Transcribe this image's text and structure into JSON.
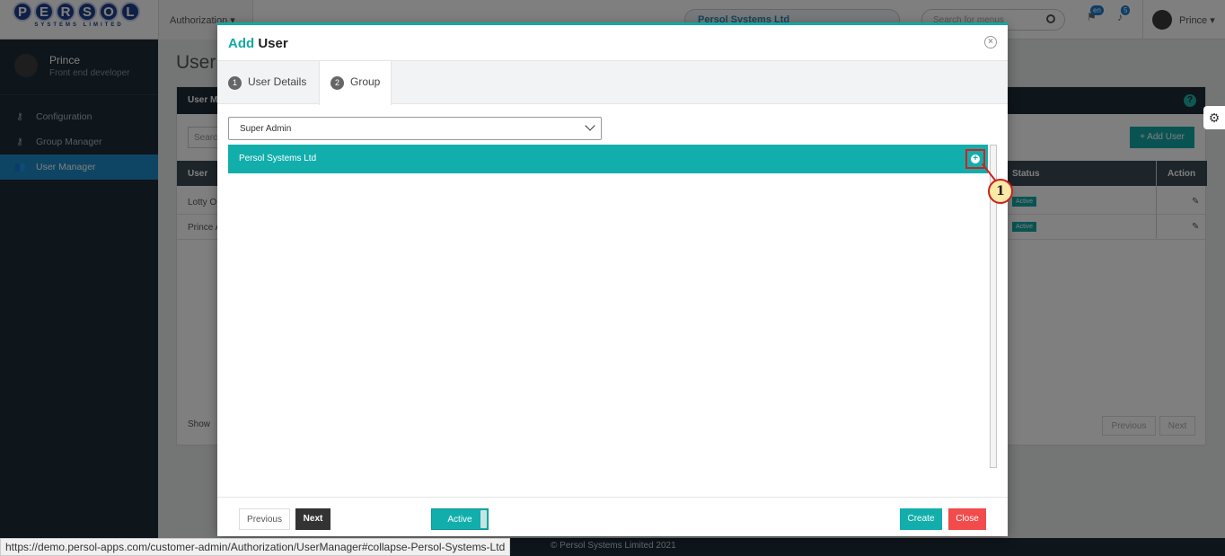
{
  "app": {
    "logo_text": "PERSOL",
    "logo_letters": [
      "P",
      "E",
      "R",
      "S",
      "O",
      "L"
    ],
    "logo_subtitle": "SYSTEMS LIMITED",
    "topnav": "Authorization ▾",
    "org_selector": "Persol Systems Ltd",
    "menu_search_placeholder": "Search for menus",
    "lang_badge": "en",
    "notif_count": "5",
    "user_menu": "Prince ▾"
  },
  "sidebar": {
    "user_name": "Prince",
    "user_role": "Front end developer",
    "items": [
      {
        "label": "Configuration",
        "icon": "key-icon",
        "active": false
      },
      {
        "label": "Group Manager",
        "icon": "key-icon",
        "active": false
      },
      {
        "label": "User Manager",
        "icon": "users-icon",
        "active": true
      }
    ]
  },
  "page": {
    "title": "User",
    "panel_title": "User Ma",
    "search_placeholder": "Searc",
    "add_user": "+ Add User",
    "columns": {
      "user": "User",
      "status": "Status",
      "action": "Action"
    },
    "rows": [
      {
        "user": "Lotty O",
        "status": "Active"
      },
      {
        "user": "Prince A",
        "status": "Active"
      }
    ],
    "show_label": "Show",
    "pager_prev": "Previous",
    "pager_next": "Next"
  },
  "footer": {
    "copyright": "© Persol Systems Limited 2021",
    "status_url": "https://demo.persol-apps.com/customer-admin/Authorization/UserManager#collapse-Persol-Systems-Ltd"
  },
  "modal": {
    "title_accent": "Add",
    "title_rest": "User",
    "tabs": [
      {
        "num": "1",
        "label": "User Details",
        "active": false
      },
      {
        "num": "2",
        "label": "Group",
        "active": true
      }
    ],
    "group_select_value": "Super Admin",
    "org_row_label": "Persol Systems Ltd",
    "callout_number": "1",
    "buttons": {
      "previous": "Previous",
      "next": "Next",
      "active_toggle": "Active",
      "create": "Create",
      "close": "Close"
    }
  },
  "colors": {
    "accent": "#12aeac",
    "danger": "#f14b4b",
    "sidebar_bg": "#1c2b36",
    "highlight": "#d42020"
  }
}
